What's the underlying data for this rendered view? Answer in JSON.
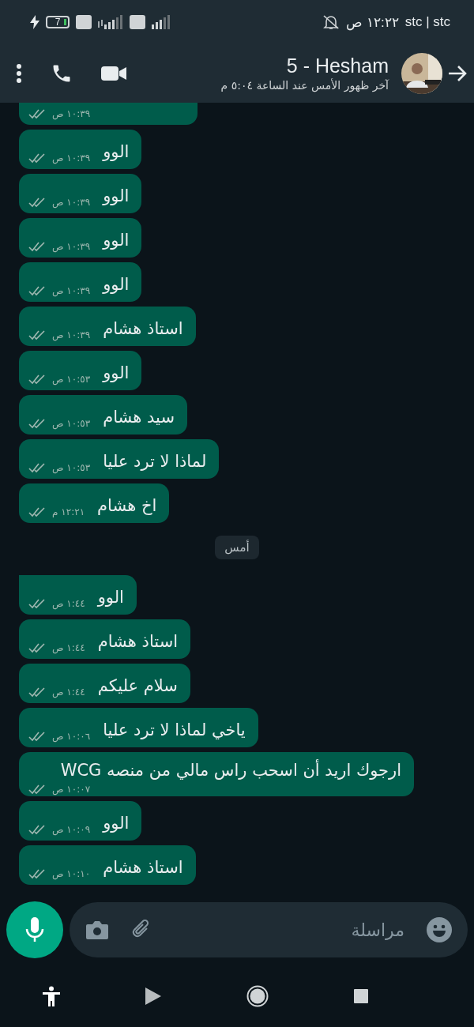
{
  "status_bar": {
    "carrier": "stc | stc",
    "time": "١٢:٢٢ ص",
    "battery": "7"
  },
  "header": {
    "name": "5 - Hesham",
    "last_seen": "آخر ظهور الأمس عند الساعة ٥:٠٤ م"
  },
  "messages": [
    {
      "kind": "partial",
      "time": "١٠:٣٩ ص",
      "read": false
    },
    {
      "kind": "message",
      "text": "الوو",
      "time": "١٠:٣٩ ص",
      "read": false,
      "tail": false
    },
    {
      "kind": "message",
      "text": "الوو",
      "time": "١٠:٣٩ ص",
      "read": false,
      "tail": false
    },
    {
      "kind": "message",
      "text": "الوو",
      "time": "١٠:٣٩ ص",
      "read": false,
      "tail": false
    },
    {
      "kind": "message",
      "text": "الوو",
      "time": "١٠:٣٩ ص",
      "read": false,
      "tail": false
    },
    {
      "kind": "message",
      "text": "استاذ هشام",
      "time": "١٠:٣٩ ص",
      "read": false,
      "tail": false
    },
    {
      "kind": "message",
      "text": "الوو",
      "time": "١٠:٥٣ ص",
      "read": false,
      "tail": false
    },
    {
      "kind": "message",
      "text": "سيد هشام",
      "time": "١٠:٥٣ ص",
      "read": false,
      "tail": false
    },
    {
      "kind": "message",
      "text": "لماذا لا ترد عليا",
      "time": "١٠:٥٣ ص",
      "read": false,
      "tail": false
    },
    {
      "kind": "message",
      "text": "اخ هشام",
      "time": "١٢:٢١ م",
      "read": false,
      "tail": false
    },
    {
      "kind": "date",
      "text": "أمس"
    },
    {
      "kind": "message",
      "text": "الوو",
      "time": "١:٤٤ ص",
      "read": false,
      "tail": true
    },
    {
      "kind": "message",
      "text": "استاذ هشام",
      "time": "١:٤٤ ص",
      "read": false,
      "tail": false
    },
    {
      "kind": "message",
      "text": "سلام عليكم",
      "time": "١:٤٤ ص",
      "read": false,
      "tail": false
    },
    {
      "kind": "message",
      "text": "ياخي لماذا لا ترد عليا",
      "time": "١٠:٠٦ ص",
      "read": false,
      "tail": false
    },
    {
      "kind": "message",
      "text": "ارجوك اريد أن اسحب راس مالي من منصه WCG",
      "time": "١٠:٠٧ ص",
      "read": false,
      "tail": false
    },
    {
      "kind": "message",
      "text": "الوو",
      "time": "١٠:٠٩ ص",
      "read": false,
      "tail": false
    },
    {
      "kind": "message",
      "text": "استاذ هشام",
      "time": "١٠:١٠ ص",
      "read": false,
      "tail": false
    }
  ],
  "composer": {
    "placeholder": "مراسلة"
  }
}
